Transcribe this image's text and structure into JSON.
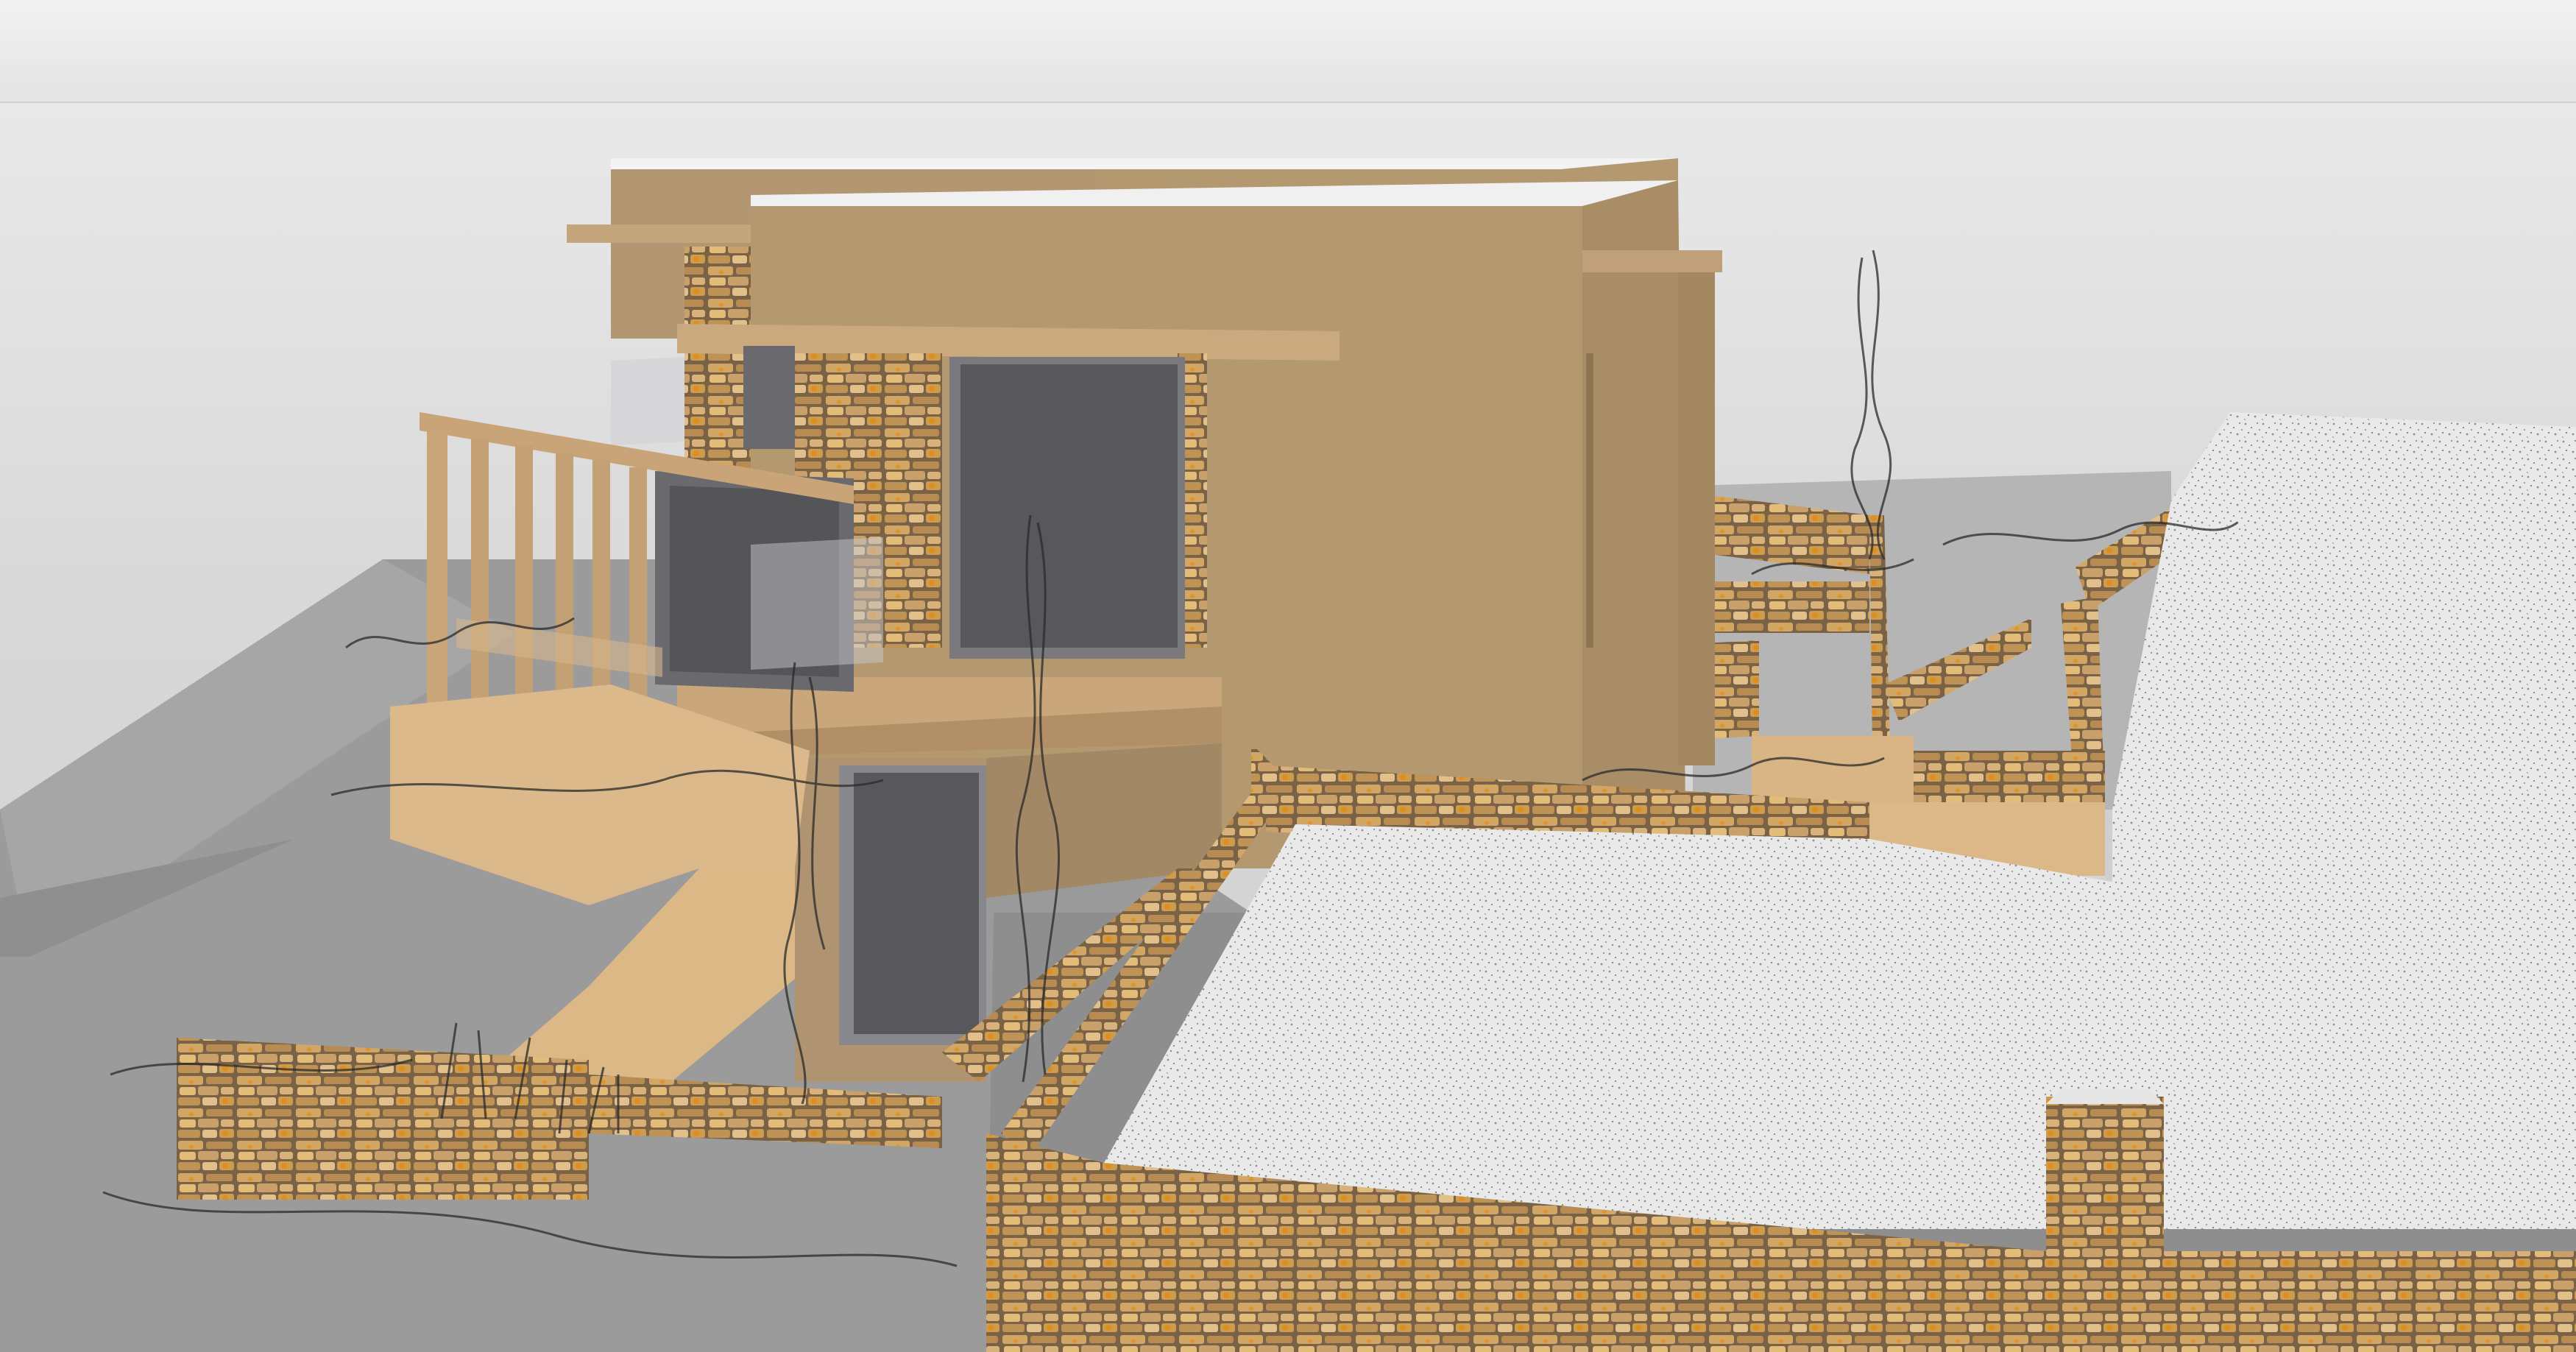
{
  "colors": {
    "toolbar": "#eaeaea",
    "sky": "#dcdcdc",
    "terrain": "#9a9a9a",
    "stucco": "#b89a72",
    "stucco_shade": "#9e8460",
    "stone_base": "#8a7050",
    "stone_light": "#d9b070",
    "glass": "#5a5a5e",
    "deck": "#e0bc8c",
    "gravel": "#e6e6e6",
    "roof_edge": "#f2f2f2"
  },
  "scene": {
    "subject": "stone-and-stucco-villa-model",
    "tool": "3d-modeling-viewport"
  }
}
